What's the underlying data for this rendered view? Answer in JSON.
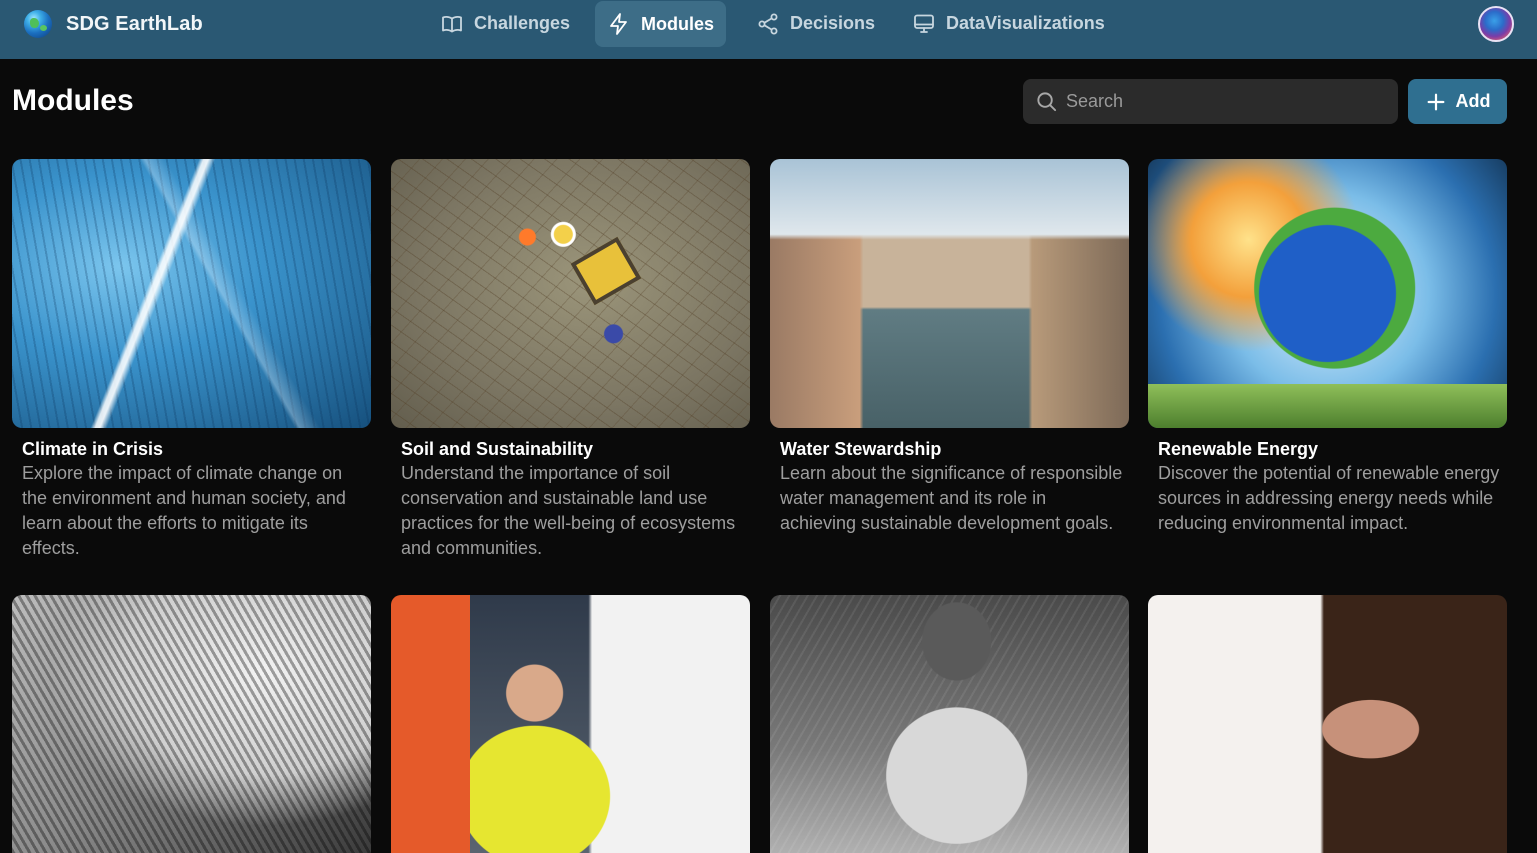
{
  "app": {
    "name": "SDG EarthLab",
    "logo_icon": "globe-icon",
    "theme_colors": {
      "nav_bg": "#2a5873",
      "accent": "#2f6f90",
      "page_bg": "#0a0a0a"
    }
  },
  "nav": {
    "items": [
      {
        "label": "Challenges",
        "icon": "book-open-icon",
        "active": false
      },
      {
        "label": "Modules",
        "icon": "lightning-icon",
        "active": true
      },
      {
        "label": "Decisions",
        "icon": "share-nodes-icon",
        "active": false
      },
      {
        "label": "DataVisualizations",
        "icon": "monitor-icon",
        "active": false
      }
    ]
  },
  "page": {
    "title": "Modules",
    "search_placeholder": "Search",
    "add_label": "Add"
  },
  "modules": [
    {
      "title": "Climate in Crisis",
      "description": "Explore the impact of climate change on the environment and human society, and learn about the efforts to mitigate its effects.",
      "image": "frozen-ice-landscape"
    },
    {
      "title": "Soil and Sustainability",
      "description": "Understand the importance of soil conservation and sustainable land use practices for the well-being of ecosystems and communities.",
      "image": "aerial-flooded-field"
    },
    {
      "title": "Water Stewardship",
      "description": "Learn about the significance of responsible water management and its role in achieving sustainable development goals.",
      "image": "venice-canal"
    },
    {
      "title": "Renewable Energy",
      "description": "Discover the potential of renewable energy sources in addressing energy needs while reducing environmental impact.",
      "image": "earth-renewable-energy"
    },
    {
      "title": "",
      "description": "",
      "image": "beekeeper-honeycomb"
    },
    {
      "title": "",
      "description": "",
      "image": "paramedic-ambulance"
    },
    {
      "title": "",
      "description": "",
      "image": "woman-portrait"
    },
    {
      "title": "",
      "description": "",
      "image": "wedding-hands"
    }
  ]
}
